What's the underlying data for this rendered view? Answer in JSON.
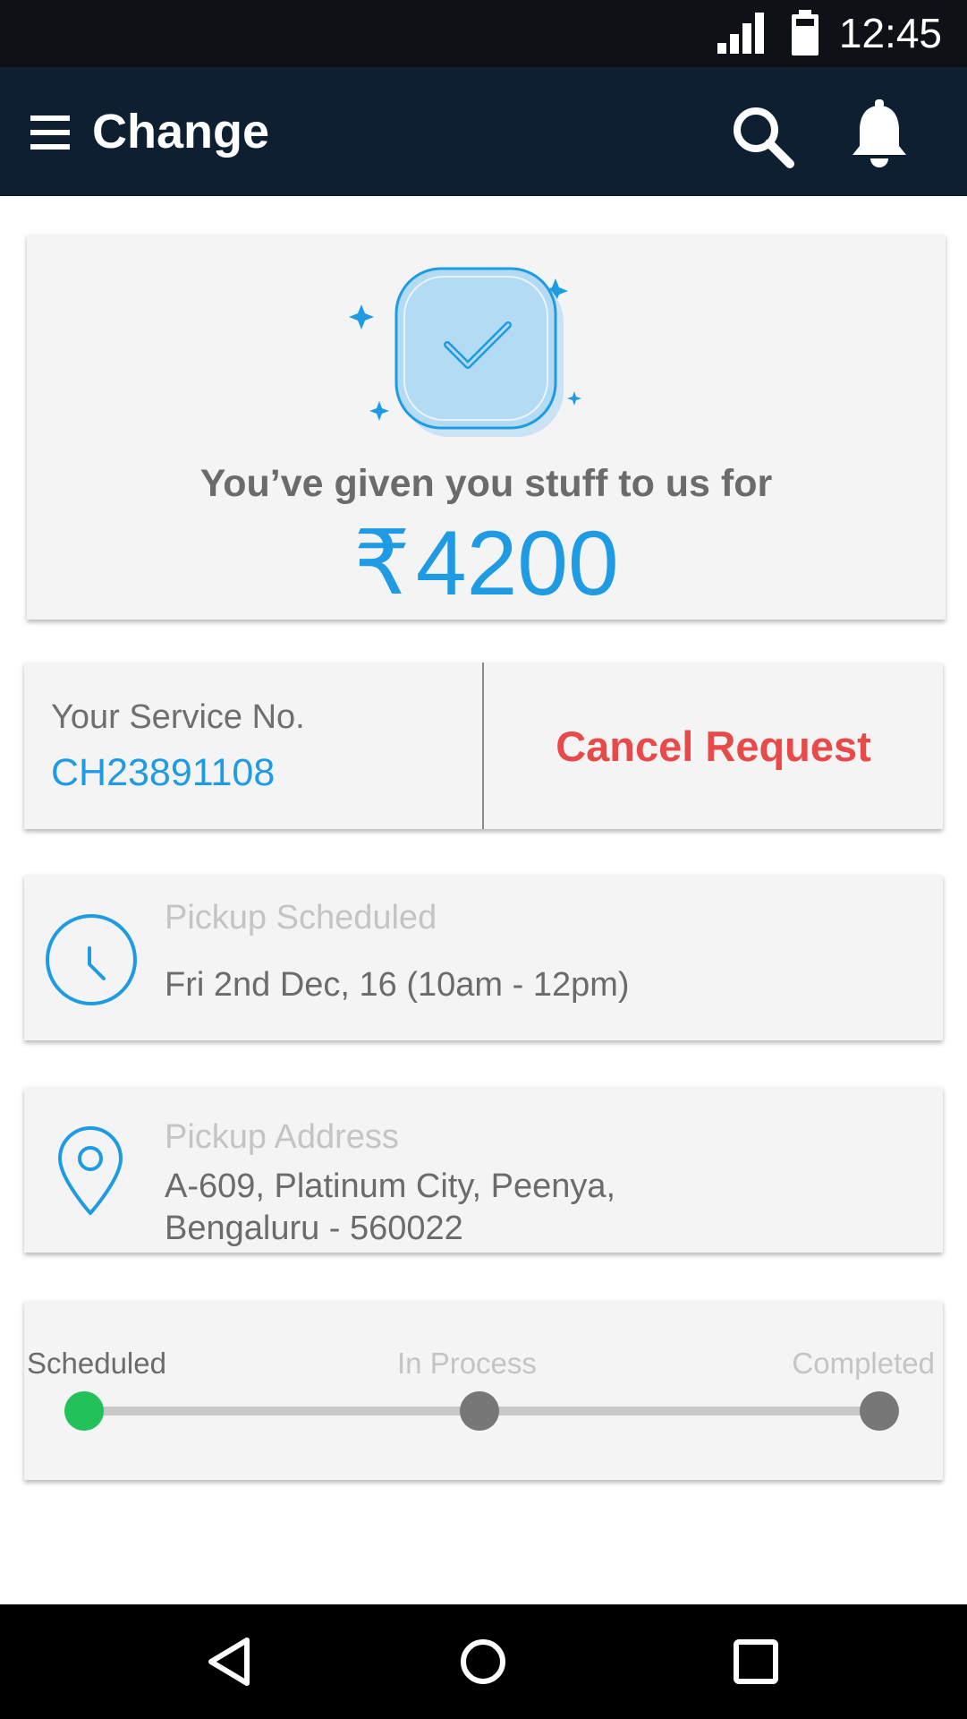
{
  "status_bar": {
    "time": "12:45"
  },
  "app_bar": {
    "title": "Change"
  },
  "summary": {
    "message": "You’ve given you stuff to us for",
    "currency_symbol": "₹",
    "amount": "4200"
  },
  "service": {
    "label": "Your Service No.",
    "number": "CH23891108",
    "cancel_label": "Cancel Request"
  },
  "schedule": {
    "label": "Pickup Scheduled",
    "value": "Fri 2nd Dec, 16 (10am - 12pm)"
  },
  "address": {
    "label": "Pickup Address",
    "line1": "A-609, Platinum City, Peenya,",
    "line2": "Bengaluru - 560022"
  },
  "progress": {
    "steps": [
      {
        "label": "Scheduled",
        "state": "done"
      },
      {
        "label": "In Process",
        "state": "pending"
      },
      {
        "label": "Completed",
        "state": "pending"
      }
    ]
  },
  "colors": {
    "accent": "#1e9be3",
    "danger": "#e84a4a",
    "success": "#23c15a",
    "app_bar": "#0d1f30"
  }
}
